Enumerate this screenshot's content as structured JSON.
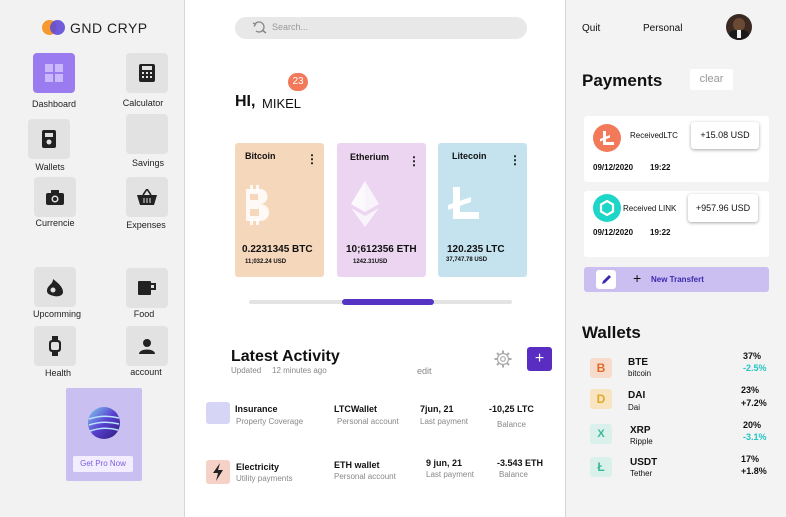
{
  "brand": {
    "name": "GND CRYP"
  },
  "sidebar": {
    "items": [
      {
        "label": "Dashboard",
        "icon": "grid-icon"
      },
      {
        "label": "Calculator",
        "icon": "calculator-icon"
      },
      {
        "label": "Wallets",
        "icon": "wallet-icon"
      },
      {
        "label": "Savings",
        "icon": "savings-icon"
      },
      {
        "label": "Currencie",
        "icon": "camera-icon"
      },
      {
        "label": "Expenses",
        "icon": "basket-icon"
      },
      {
        "label": "Upcomming",
        "icon": "drop-icon"
      },
      {
        "label": "Food",
        "icon": "coffee-icon"
      },
      {
        "label": "Health",
        "icon": "watch-icon"
      },
      {
        "label": "account",
        "icon": "user-icon"
      }
    ],
    "promo_button": "Get Pro Now"
  },
  "search": {
    "placeholder": "Search..."
  },
  "notifications": {
    "count": "23"
  },
  "greeting": {
    "hi": "HI,",
    "name": "MIKEL"
  },
  "cards": [
    {
      "title": "Bitcoin",
      "amount": "0.2231345 BTC",
      "usd": "11;032.24 USD",
      "color": "#f5d7bc"
    },
    {
      "title": "Etherium",
      "amount": "10;612356 ETH",
      "usd": "1242.31USD",
      "color": "#ecd5f1"
    },
    {
      "title": "Litecoin",
      "amount": "120.235 LTC",
      "usd": "37,747.78 USD",
      "color": "#c4e3ef"
    }
  ],
  "activity": {
    "title": "Latest  Activity",
    "updated": "Updated",
    "ago": "12 minutes ago",
    "edit": "edit",
    "rows": [
      {
        "name": "Insurance",
        "sub": "Property Coverage",
        "wallet": "LTCWallet",
        "wallet_sub": "Personal account",
        "date": "7jun, 21",
        "date_sub": "Last payment",
        "amount": "-10,25 LTC",
        "amount_sub": "Balance"
      },
      {
        "name": "Electricity",
        "sub": "Utility payments",
        "wallet": "ETH wallet",
        "wallet_sub": "Personal account",
        "date": "9 jun, 21",
        "date_sub": "Last payment",
        "amount": "-3.543 ETH",
        "amount_sub": "Balance"
      }
    ]
  },
  "topbar": {
    "quit": "Quit",
    "personal": "Personal"
  },
  "payments": {
    "title": "Payments",
    "clear": "clear",
    "items": [
      {
        "label": "ReceivedLTC",
        "amount": "+15.08 USD",
        "date": "09/12/2020",
        "time": "19:22",
        "color": "#f27a5a"
      },
      {
        "label": "Received LINK",
        "amount": "+957.96 USD",
        "date": "09/12/2020",
        "time": "19:22",
        "color": "#1ed6c8"
      }
    ],
    "new_transfer": "New Transfert"
  },
  "wallets": {
    "title": "Wallets",
    "items": [
      {
        "symbol": "BTE",
        "name": "bitcoin",
        "pct": "37%",
        "change": "-2.5%",
        "change_color": "#23c4c4",
        "icon_bg": "#f7dccb",
        "icon_color": "#e0692a",
        "glyph": "B"
      },
      {
        "symbol": "DAI",
        "name": "Dai",
        "pct": "23%",
        "change": "+7.2%",
        "change_color": "#111111",
        "icon_bg": "#f8e5bf",
        "icon_color": "#e0a72a",
        "glyph": "D"
      },
      {
        "symbol": "XRP",
        "name": "Ripple",
        "pct": "20%",
        "change": "-3.1%",
        "change_color": "#23c4c4",
        "icon_bg": "#d9f1ea",
        "icon_color": "#3ab89a",
        "glyph": "X"
      },
      {
        "symbol": "USDT",
        "name": "Tether",
        "pct": "17%",
        "change": "+1.8%",
        "change_color": "#111111",
        "icon_bg": "#d9f1ea",
        "icon_color": "#3ab89a",
        "glyph": "Ł"
      }
    ]
  }
}
